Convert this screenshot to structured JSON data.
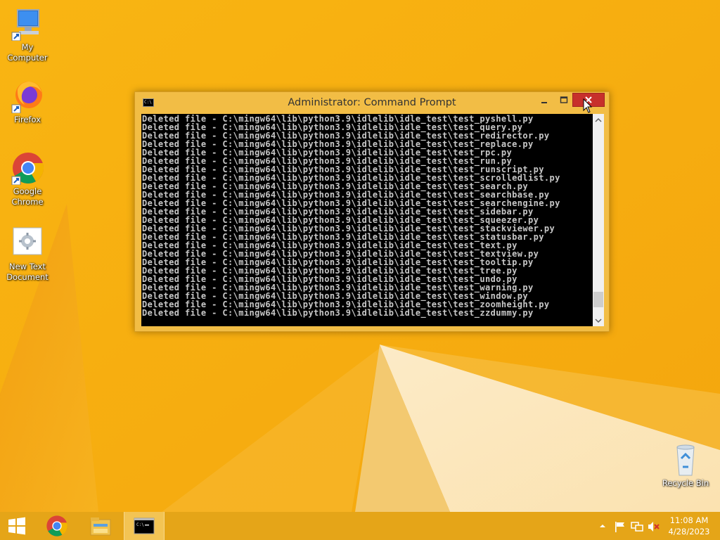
{
  "desktop": {
    "icons": [
      {
        "label": "My Computer"
      },
      {
        "label": "Firefox"
      },
      {
        "label": "Google Chrome"
      },
      {
        "label": "New Text Document"
      },
      {
        "label": "Recycle Bin"
      }
    ]
  },
  "window": {
    "title": "Administrator:  Command Prompt",
    "icon_text": "C:\\",
    "lines": [
      "Deleted file - C:\\mingw64\\lib\\python3.9\\idlelib\\idle_test\\test_pyshell.py",
      "Deleted file - C:\\mingw64\\lib\\python3.9\\idlelib\\idle_test\\test_query.py",
      "Deleted file - C:\\mingw64\\lib\\python3.9\\idlelib\\idle_test\\test_redirector.py",
      "Deleted file - C:\\mingw64\\lib\\python3.9\\idlelib\\idle_test\\test_replace.py",
      "Deleted file - C:\\mingw64\\lib\\python3.9\\idlelib\\idle_test\\test_rpc.py",
      "Deleted file - C:\\mingw64\\lib\\python3.9\\idlelib\\idle_test\\test_run.py",
      "Deleted file - C:\\mingw64\\lib\\python3.9\\idlelib\\idle_test\\test_runscript.py",
      "Deleted file - C:\\mingw64\\lib\\python3.9\\idlelib\\idle_test\\test_scrolledlist.py",
      "Deleted file - C:\\mingw64\\lib\\python3.9\\idlelib\\idle_test\\test_search.py",
      "Deleted file - C:\\mingw64\\lib\\python3.9\\idlelib\\idle_test\\test_searchbase.py",
      "Deleted file - C:\\mingw64\\lib\\python3.9\\idlelib\\idle_test\\test_searchengine.py",
      "Deleted file - C:\\mingw64\\lib\\python3.9\\idlelib\\idle_test\\test_sidebar.py",
      "Deleted file - C:\\mingw64\\lib\\python3.9\\idlelib\\idle_test\\test_squeezer.py",
      "Deleted file - C:\\mingw64\\lib\\python3.9\\idlelib\\idle_test\\test_stackviewer.py",
      "Deleted file - C:\\mingw64\\lib\\python3.9\\idlelib\\idle_test\\test_statusbar.py",
      "Deleted file - C:\\mingw64\\lib\\python3.9\\idlelib\\idle_test\\test_text.py",
      "Deleted file - C:\\mingw64\\lib\\python3.9\\idlelib\\idle_test\\test_textview.py",
      "Deleted file - C:\\mingw64\\lib\\python3.9\\idlelib\\idle_test\\test_tooltip.py",
      "Deleted file - C:\\mingw64\\lib\\python3.9\\idlelib\\idle_test\\test_tree.py",
      "Deleted file - C:\\mingw64\\lib\\python3.9\\idlelib\\idle_test\\test_undo.py",
      "Deleted file - C:\\mingw64\\lib\\python3.9\\idlelib\\idle_test\\test_warning.py",
      "Deleted file - C:\\mingw64\\lib\\python3.9\\idlelib\\idle_test\\test_window.py",
      "Deleted file - C:\\mingw64\\lib\\python3.9\\idlelib\\idle_test\\test_zoomheight.py",
      "Deleted file - C:\\mingw64\\lib\\python3.9\\idlelib\\idle_test\\test_zzdummy.py"
    ],
    "scroll_position": 0.96
  },
  "taskbar": {
    "pinned": [
      {
        "icon": "windows-start-icon"
      },
      {
        "icon": "chrome-icon"
      },
      {
        "icon": "file-explorer-icon"
      },
      {
        "icon": "command-prompt-icon",
        "active": true
      }
    ],
    "tray_icons": [
      "chevron-up-icon",
      "action-center-flag-icon",
      "network-icon",
      "volume-muted-icon"
    ],
    "clock": {
      "time": "11:08 AM",
      "date": "4/28/2023"
    }
  },
  "colors": {
    "wallpaper": "#f6b414",
    "taskbar": "#e5a518",
    "close_button": "#c7302b",
    "console_bg": "#000000",
    "console_text": "#c8c8c8"
  }
}
